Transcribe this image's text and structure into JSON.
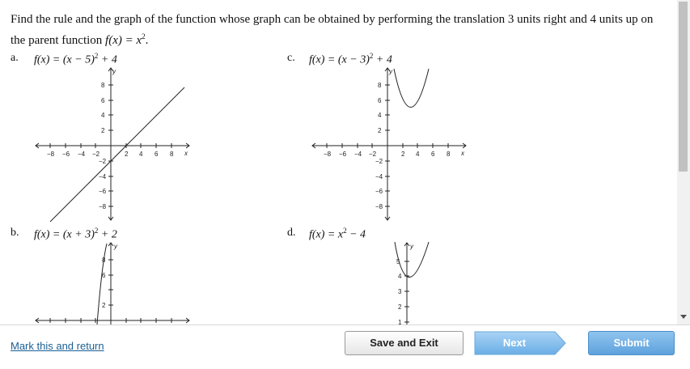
{
  "question": {
    "text": "Find the rule and the graph of the function whose graph can be obtained by performing the translation 3 units right and 4 units up on the parent function",
    "parent_function": "f(x) = x",
    "parent_exponent": "2"
  },
  "choices": [
    {
      "letter": "a.",
      "formula_left": "f(x) = (x − 5)",
      "exponent": "2",
      "formula_right": " + 4"
    },
    {
      "letter": "b.",
      "formula_left": "f(x) = (x + 3)",
      "exponent": "2",
      "formula_right": " + 2"
    },
    {
      "letter": "c.",
      "formula_left": "f(x) = (x − 3)",
      "exponent": "2",
      "formula_right": " + 4"
    },
    {
      "letter": "d.",
      "formula_left": "f(x) = x",
      "exponent": "2",
      "formula_right": " − 4"
    }
  ],
  "graph_labels": {
    "x_axis": "x",
    "y_axis": "y",
    "x_ticks": [
      "−8",
      "−6",
      "−4",
      "−2",
      "2",
      "4",
      "6",
      "8"
    ],
    "y_ticks_neg": [
      "−2",
      "−4",
      "−6",
      "−8"
    ],
    "y_ticks_pos": [
      "2",
      "4",
      "6",
      "8"
    ],
    "d_ticks": [
      "5",
      "4",
      "3",
      "2",
      "1"
    ]
  },
  "footer": {
    "mark_link": "Mark this and return",
    "save_label": "Save and Exit",
    "next_label": "Next",
    "submit_label": "Submit"
  },
  "colors": {
    "link": "#1a5f94",
    "next_button": "#7db9ea",
    "submit_button": "#5ea2dc"
  }
}
